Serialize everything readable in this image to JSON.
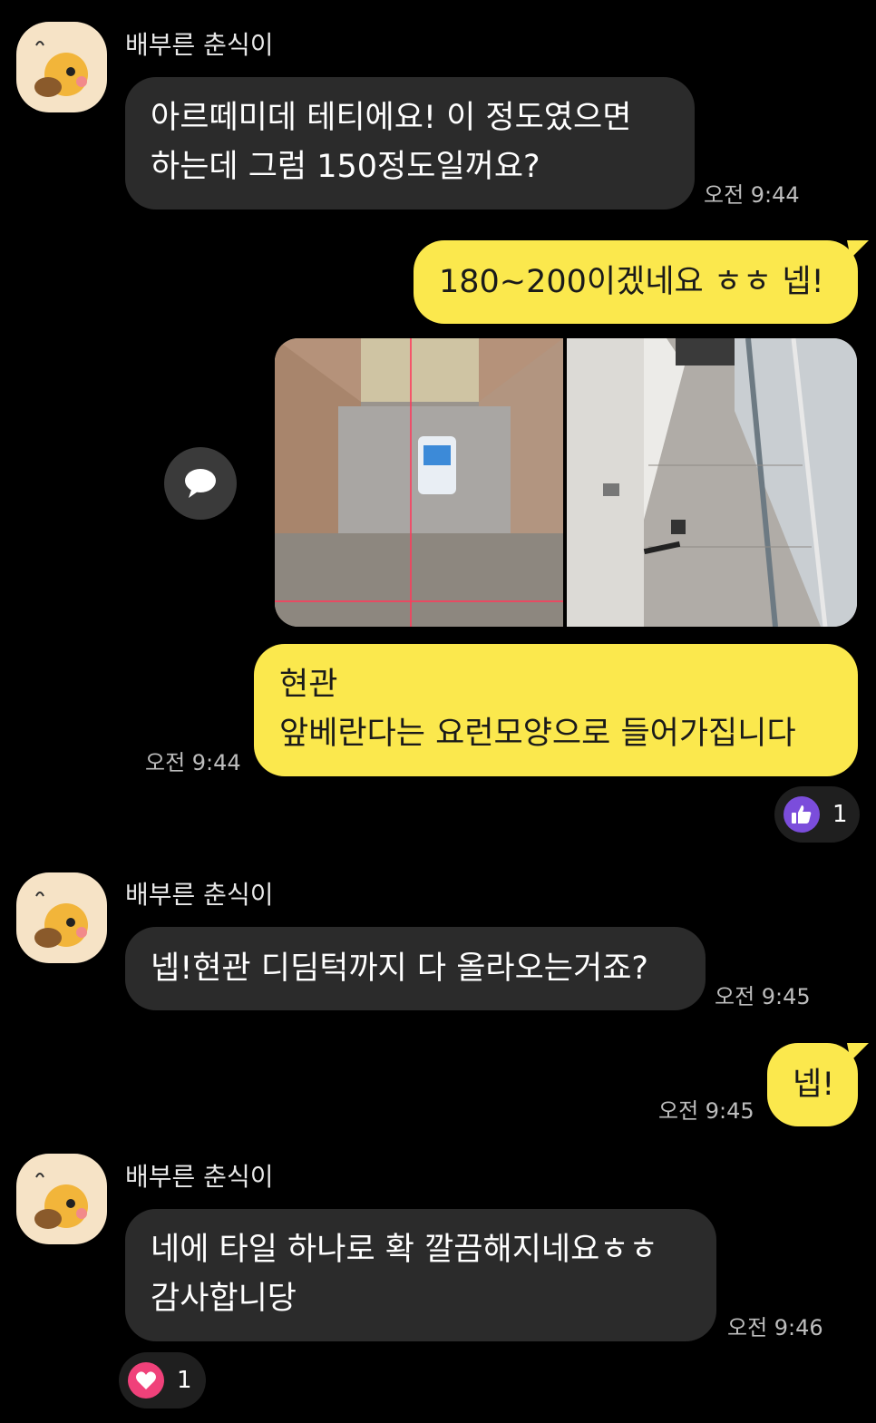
{
  "messages": {
    "m1": {
      "sender": "배부른 춘식이",
      "lines": [
        "아르떼미데 테티에요! 이 정도였으면",
        "하는데 그럼 150정도일꺼요?"
      ],
      "time": "오전 9:44"
    },
    "m2": {
      "text": "180~200이겠네요 ㅎㅎ 넵!"
    },
    "m3": {
      "lines": [
        "현관",
        "앞베란다는 요런모양으로 들어가집니다"
      ],
      "time": "오전 9:44",
      "reaction": {
        "icon": "thumbs-up-icon",
        "count": "1",
        "color": "#7b4ddb"
      }
    },
    "m4": {
      "sender": "배부른 춘식이",
      "text": "넵!현관 디딤턱까지 다 올라오는거죠?",
      "time": "오전 9:45"
    },
    "m5": {
      "text": "넵!",
      "time": "오전 9:45"
    },
    "m6": {
      "sender": "배부른 춘식이",
      "lines": [
        "네에 타일 하나로 확 깔끔해지네요ㅎㅎ",
        "감사합니당"
      ],
      "time": "오전 9:46",
      "reaction": {
        "icon": "heart-icon",
        "count": "1",
        "color": "#f0417a"
      }
    }
  },
  "colors": {
    "incoming": "#2b2b2b",
    "outgoing": "#fbe84d",
    "background": "#000000"
  }
}
